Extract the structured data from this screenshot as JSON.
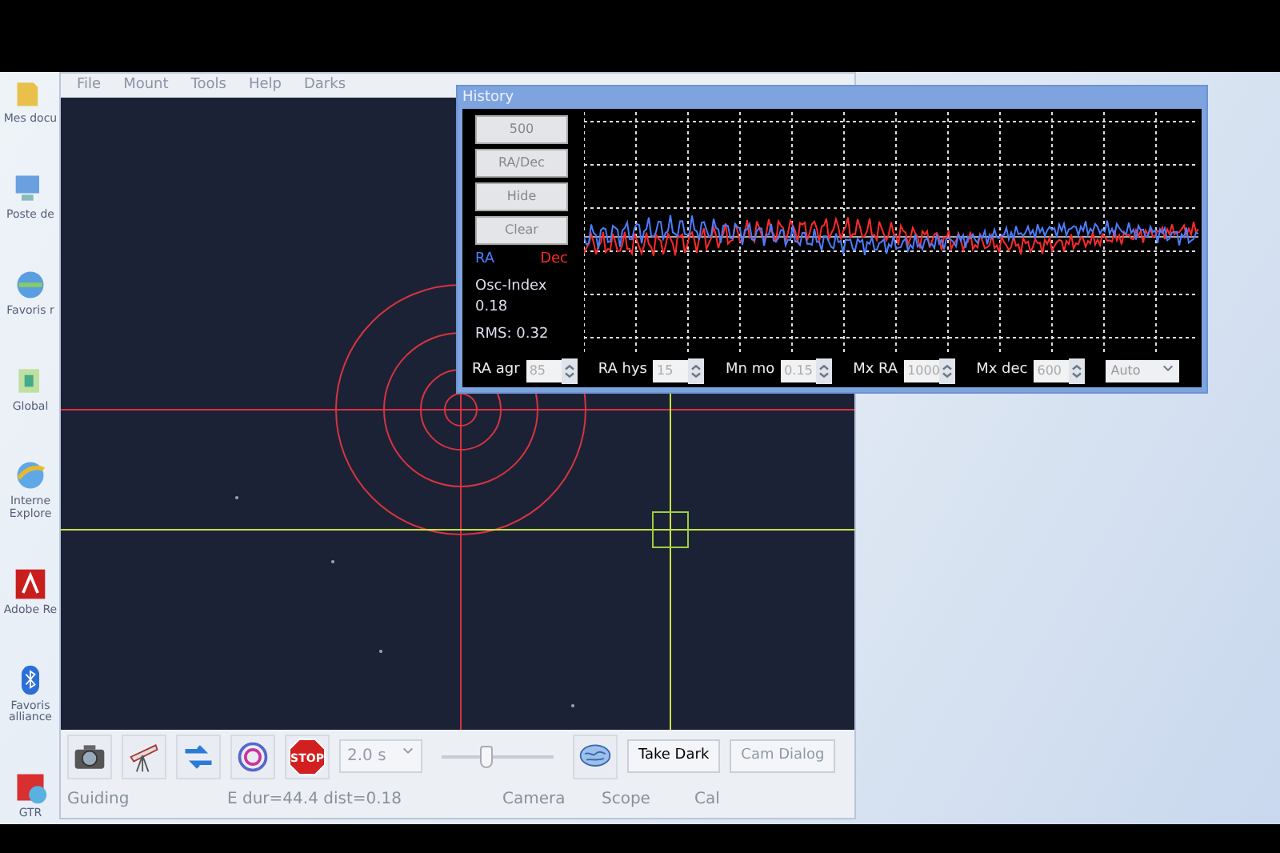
{
  "desktop_icons": [
    {
      "label": "Mes docu"
    },
    {
      "label": "Poste de"
    },
    {
      "label": "Favoris r"
    },
    {
      "label": "Global"
    },
    {
      "label": "Interne Explore"
    },
    {
      "label": "Adobe Re"
    },
    {
      "label": "Favoris alliance"
    },
    {
      "label": "GTR"
    }
  ],
  "main_window": {
    "menu": [
      "File",
      "Mount",
      "Tools",
      "Help",
      "Darks"
    ],
    "toolbar": {
      "stop_label": "STOP",
      "exposure": "2.0 s",
      "gamma": {
        "level": 0.4
      },
      "buttons": [
        {
          "label": "Take Dark",
          "disabled": false
        },
        {
          "label": "Cam Dialog",
          "disabled": true
        }
      ]
    },
    "status_bar": [
      "Guiding",
      "E dur=44.4 dist=0.18",
      "Camera",
      "Scope",
      "Cal"
    ]
  },
  "history": {
    "title": "History",
    "buttons": [
      "500",
      "RA/Dec",
      "Hide",
      "Clear"
    ],
    "legend": [
      {
        "label": "RA",
        "color": "#4d7dff"
      },
      {
        "label": "Dec",
        "color": "#ff2a2a"
      }
    ],
    "osc_label": "Osc-Index",
    "osc_value": "0.18",
    "rms": "RMS: 0.32",
    "params": [
      {
        "label": "RA agr",
        "value": "85"
      },
      {
        "label": "RA hys",
        "value": "15"
      },
      {
        "label": "Mn mo",
        "value": "0.15"
      },
      {
        "label": "Mx RA",
        "value": "1000"
      },
      {
        "label": "Mx dec",
        "value": "600"
      }
    ],
    "mode": "Auto"
  }
}
